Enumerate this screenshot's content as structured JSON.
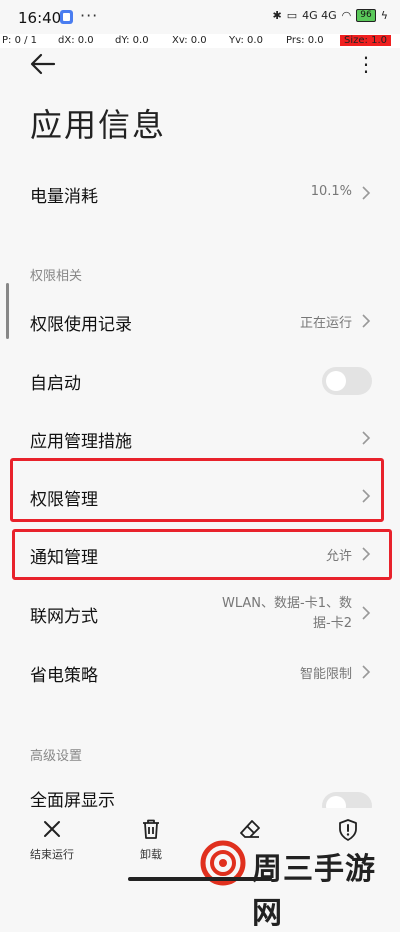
{
  "status_bar": {
    "time": "16:40",
    "more": "···",
    "network": "4G 4G",
    "battery": "96"
  },
  "debug": {
    "p": "P: 0 / 1",
    "dx": "dX: 0.0",
    "dy": "dY: 0.0",
    "xv": "Xv: 0.0",
    "yv": "Yv: 0.0",
    "prs": "Prs: 0.0",
    "size": "Size: 1.0"
  },
  "header": {
    "title": "应用信息"
  },
  "rows": {
    "battery": {
      "label": "电量消耗",
      "value": "10.1%"
    },
    "permission_section": "权限相关",
    "permission_log": {
      "label": "权限使用记录",
      "value": "正在运行"
    },
    "autostart": {
      "label": "自启动",
      "enabled": false
    },
    "app_control": {
      "label": "应用管理措施"
    },
    "permission_manage": {
      "label": "权限管理"
    },
    "notification": {
      "label": "通知管理",
      "value": "允许"
    },
    "network": {
      "label": "联网方式",
      "value_line1": "WLAN、数据-卡1、数",
      "value_line2": "据-卡2"
    },
    "power_saving": {
      "label": "省电策略",
      "value": "智能限制"
    },
    "advanced_section": "高级设置",
    "fullscreen": {
      "label": "全面屏显示"
    }
  },
  "bottom_bar": {
    "stop": "结束运行",
    "uninstall": "卸载",
    "clear": "",
    "security": ""
  },
  "watermark": {
    "text": "周三手游网"
  },
  "colors": {
    "highlight": "#e8222b",
    "toggle_off": "#e3e3e3",
    "watermark_red": "#e0301e"
  }
}
